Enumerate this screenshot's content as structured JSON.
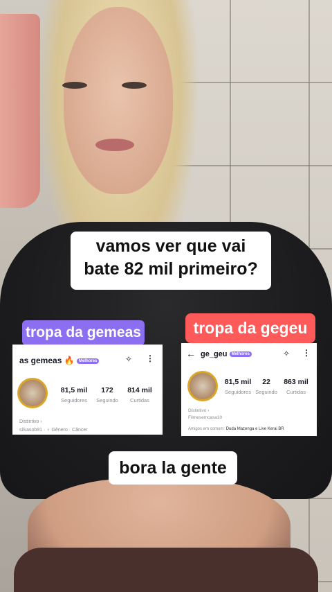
{
  "captions": {
    "main_line1": "vamos ver que vai",
    "main_line2": "bate 82 mil primeiro?",
    "bottom": "bora la gente"
  },
  "tags": {
    "left": "tropa da gemeas",
    "right": "tropa da gegeu"
  },
  "card_left": {
    "username": "as gemeas",
    "emoji": "🔥",
    "badge": "Melhores",
    "stats": [
      {
        "value": "81,5 mil",
        "label": "Seguidores"
      },
      {
        "value": "172",
        "label": "Seguindo"
      },
      {
        "value": "814 mil",
        "label": "Curtidas"
      }
    ],
    "line1": "Distintivo ›",
    "line2": "silvasob91 · ♀ Gênero · Câncer"
  },
  "card_right": {
    "username": "ge_geu",
    "badge": "Melhores",
    "stats": [
      {
        "value": "81,5 mil",
        "label": "Seguidores"
      },
      {
        "value": "22",
        "label": "Seguindo"
      },
      {
        "value": "863 mil",
        "label": "Curtidas"
      }
    ],
    "line1": "Distintivo ›",
    "line2": "Filmesemcasa10",
    "line3_prefix": "Amigos em comum:",
    "line3_names": "Duda Mazenga e Live Kerai BR"
  }
}
